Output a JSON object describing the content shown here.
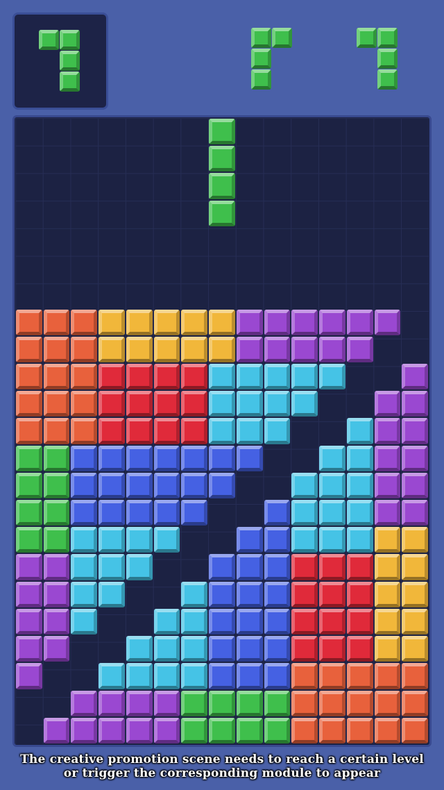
{
  "colors": {
    "O": "#e8613c",
    "Y": "#f1b73a",
    "P": "#9a48d1",
    "R": "#e02a3a",
    "C": "#45c3e6",
    "G": "#3fbf4c",
    "B": "#4561e3"
  },
  "hold_piece": {
    "name": "hold-piece-green",
    "color": "G",
    "cells": [
      [
        0,
        0
      ],
      [
        0,
        1
      ],
      [
        1,
        1
      ],
      [
        2,
        1
      ]
    ]
  },
  "next_pieces": [
    {
      "name": "next-piece-1",
      "color": "G",
      "cells": [
        [
          0,
          0
        ],
        [
          0,
          1
        ],
        [
          1,
          0
        ],
        [
          2,
          0
        ]
      ]
    },
    {
      "name": "next-piece-2",
      "color": "G",
      "cells": [
        [
          0,
          0
        ],
        [
          0,
          1
        ],
        [
          1,
          1
        ],
        [
          2,
          1
        ]
      ]
    }
  ],
  "active_piece": {
    "name": "falling-i-piece",
    "color": "G",
    "cells": [
      [
        0,
        7
      ],
      [
        1,
        7
      ],
      [
        2,
        7
      ],
      [
        3,
        7
      ]
    ]
  },
  "board": {
    "rows": 23,
    "cols": 15,
    "cells": [
      "...............",
      "...............",
      "...............",
      "...............",
      "...............",
      "...............",
      "...............",
      "OOOYYYYYPPPPPP.",
      "OOOYYYYYPPPPP..",
      "OOORRRRCCCCC..P",
      "OOORRRRCCCC..PP",
      "OOORRRRCCC..CPP",
      "GGBBBBBBB..CCPP",
      "GGBBBBBB..CCCPP",
      "GGBBBBB..BCCCPP",
      "GGCCCC..BBCCCYY",
      "PPCCC..BBBRRRYY",
      "PPCC..CBBBRRRYY",
      "PPC..CCBBBRRRYY",
      "PP..CCCBBBRRRYY",
      "P..CCCCBBBOOOOO",
      "..PPPPGGGGOOOOO",
      ".PPPPPGGGGOOOOO"
    ]
  },
  "caption": {
    "line1": "The creative promotion scene needs to reach a certain level",
    "line2": "or trigger the corresponding module to appear"
  }
}
